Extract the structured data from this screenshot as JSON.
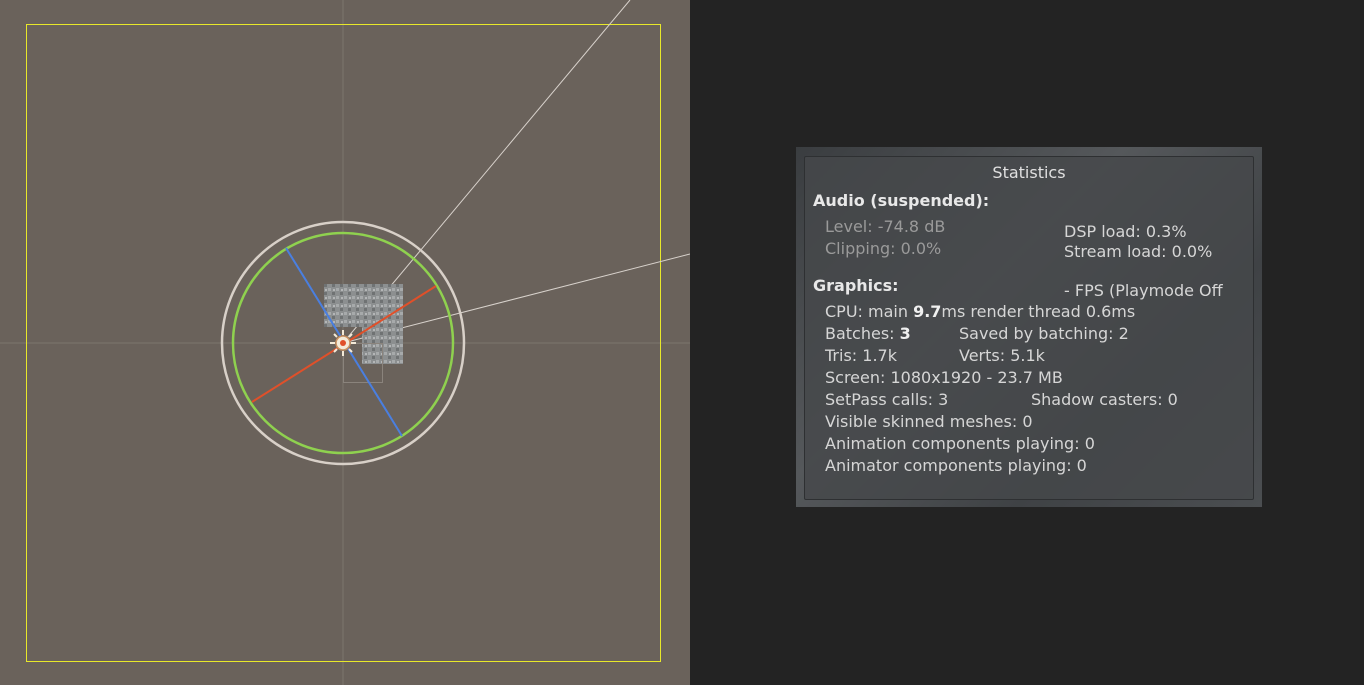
{
  "statistics": {
    "title": "Statistics",
    "audio": {
      "header": "Audio (suspended):",
      "level": "Level: -74.8 dB",
      "clipping": "Clipping: 0.0%",
      "dsp_load": "DSP load: 0.3%",
      "stream_load": "Stream load: 0.0%"
    },
    "graphics": {
      "header": "Graphics:",
      "fps": "- FPS (Playmode Off",
      "cpu_prefix": "CPU: main ",
      "cpu_main": "9.7",
      "cpu_suffix": "ms  render thread 0.6ms",
      "batches_prefix": "Batches: ",
      "batches": "3",
      "saved_by_batching": "Saved by batching: 2",
      "tris": "Tris: 1.7k",
      "verts": "Verts: 5.1k",
      "screen": "Screen: 1080x1920 - 23.7 MB",
      "setpass_calls": "SetPass calls: 3",
      "shadow_casters": "Shadow casters: 0",
      "visible_skinned_meshes": "Visible skinned meshes: 0",
      "animation_components": "Animation components playing: 0",
      "animator_components": "Animator components playing: 0"
    }
  },
  "colors": {
    "scene_background": "#6a625b",
    "game_view_background": "#232323",
    "camera_bounds": "#e8e82a",
    "gizmo_green": "#8fd14f",
    "gizmo_blue": "#4a7fe0",
    "gizmo_red": "#e0502a",
    "gizmo_outer_ring": "#d8d0c8"
  }
}
